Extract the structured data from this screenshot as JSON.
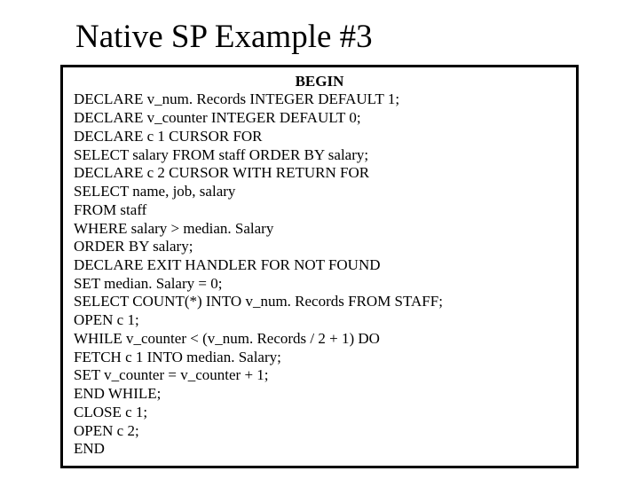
{
  "title": "Native SP Example #3",
  "begin": "BEGIN",
  "code": {
    "l1": "DECLARE v_num. Records INTEGER DEFAULT 1;",
    "l2": "DECLARE v_counter INTEGER DEFAULT 0;",
    "l3": "DECLARE c 1 CURSOR FOR",
    "l4": "SELECT salary FROM staff ORDER BY salary;",
    "l5": "DECLARE c 2 CURSOR WITH RETURN FOR",
    "l6": "SELECT name, job, salary",
    "l7": "FROM staff",
    "l8": "WHERE salary > median. Salary",
    "l9": "ORDER BY salary;",
    "l10": "DECLARE EXIT HANDLER FOR NOT FOUND",
    "l11": "SET median. Salary = 0;",
    "l12": "SELECT COUNT(*) INTO v_num. Records FROM STAFF;",
    "l13": "OPEN c 1;",
    "l14": "WHILE v_counter < (v_num. Records / 2 + 1) DO",
    "l15": "FETCH c 1 INTO median. Salary;",
    "l16": "SET v_counter = v_counter + 1;",
    "l17": "END WHILE;",
    "l18": "CLOSE c 1;",
    "l19": "OPEN c 2;",
    "l20": "END"
  }
}
